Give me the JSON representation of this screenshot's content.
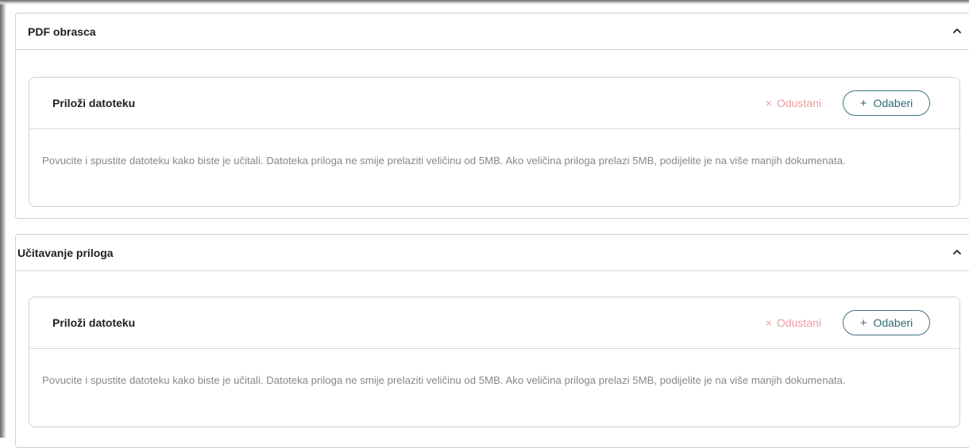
{
  "sections": [
    {
      "title": "PDF obrasca",
      "upload": {
        "title": "Priloži datoteku",
        "cancel_label": "Odustani",
        "cancel_icon": "×",
        "choose_label": "Odaberi",
        "choose_icon": "+",
        "help_text": "Povucite i spustite datoteku kako biste je učitali. Datoteka priloga ne smije prelaziti veličinu od 5MB. Ako veličina priloga prelazi 5MB, podijelite je na više manjih dokumenata."
      }
    },
    {
      "title": "Učitavanje priloga",
      "upload": {
        "title": "Priloži datoteku",
        "cancel_label": "Odustani",
        "cancel_icon": "×",
        "choose_label": "Odaberi",
        "choose_icon": "+",
        "help_text": "Povucite i spustite datoteku kako biste je učitali. Datoteka priloga ne smije prelaziti veličinu od 5MB. Ako veličina priloga prelazi 5MB, podijelite je na više manjih dokumenata."
      }
    }
  ],
  "icons": {
    "collapse": "chevron-up-icon"
  },
  "colors": {
    "accent": "#2f6a76",
    "cancel": "#ee9aa3",
    "muted_text": "#888888",
    "border": "#d0d0d0"
  }
}
